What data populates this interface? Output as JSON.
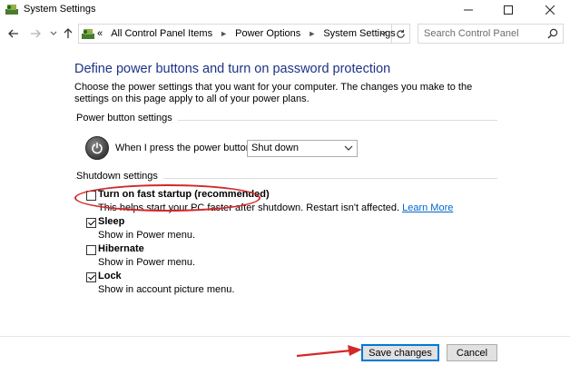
{
  "window": {
    "title": "System Settings",
    "controls": {
      "minimize": "minimize-icon",
      "maximize": "maximize-icon",
      "close": "close-icon"
    }
  },
  "nav": {
    "breadcrumb_prefix": "«",
    "breadcrumbs": [
      "All Control Panel Items",
      "Power Options",
      "System Settings"
    ],
    "search_placeholder": "Search Control Panel"
  },
  "main": {
    "heading": "Define power buttons and turn on password protection",
    "intro": "Choose the power settings that you want for your computer. The changes you make to the settings on this page apply to all of your power plans.",
    "power_group_label": "Power button settings",
    "power_button_label": "When I press the power button:",
    "power_button_value": "Shut down",
    "shutdown_group_label": "Shutdown settings",
    "options": [
      {
        "label": "Turn on fast startup (recommended)",
        "checked": false,
        "desc": "This helps start your PC faster after shutdown. Restart isn't affected.",
        "link": "Learn More"
      },
      {
        "label": "Sleep",
        "checked": true,
        "desc": "Show in Power menu."
      },
      {
        "label": "Hibernate",
        "checked": false,
        "desc": "Show in Power menu."
      },
      {
        "label": "Lock",
        "checked": true,
        "desc": "Show in account picture menu."
      }
    ]
  },
  "footer": {
    "save_label": "Save changes",
    "cancel_label": "Cancel"
  },
  "colors": {
    "heading": "#1e3287",
    "link": "#0066cc",
    "annotation": "#d42828",
    "primary_border": "#0078d7"
  }
}
